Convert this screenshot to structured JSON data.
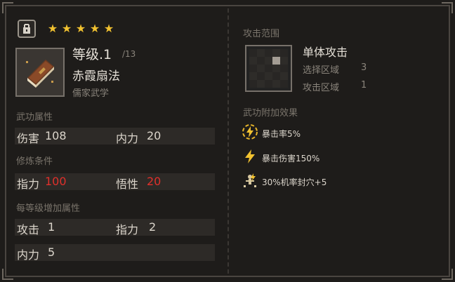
{
  "header": {
    "rating_stars": 5
  },
  "skill": {
    "level_label": "等级.1",
    "level_max": "/13",
    "name": "赤霞扇法",
    "school": "儒家武学"
  },
  "attributes": {
    "title": "武功属性",
    "items": [
      {
        "label": "伤害",
        "value": "108"
      },
      {
        "label": "内力",
        "value": "20"
      }
    ]
  },
  "requirements": {
    "title": "修炼条件",
    "items": [
      {
        "label": "指力",
        "value": "100",
        "color": "#e0302b"
      },
      {
        "label": "悟性",
        "value": "20",
        "color": "#e0302b"
      }
    ]
  },
  "per_level": {
    "title": "每等级增加属性",
    "items": [
      {
        "label": "攻击",
        "value": "1"
      },
      {
        "label": "指力",
        "value": "2"
      },
      {
        "label": "内力",
        "value": "5"
      }
    ]
  },
  "range": {
    "title": "攻击范围",
    "type": "单体攻击",
    "select_label": "选择区域",
    "select_value": "3",
    "attack_label": "攻击区域",
    "attack_value": "1"
  },
  "effects": {
    "title": "武功附加效果",
    "items": [
      {
        "icon": "crit-rate-icon",
        "text": "暴击率5%"
      },
      {
        "icon": "lightning-icon",
        "text": "暴击伤害150%"
      },
      {
        "icon": "acupoint-seal-icon",
        "text": "30%机率封穴+5"
      }
    ]
  },
  "colors": {
    "star": "#f2c230",
    "warn": "#e0302b"
  }
}
